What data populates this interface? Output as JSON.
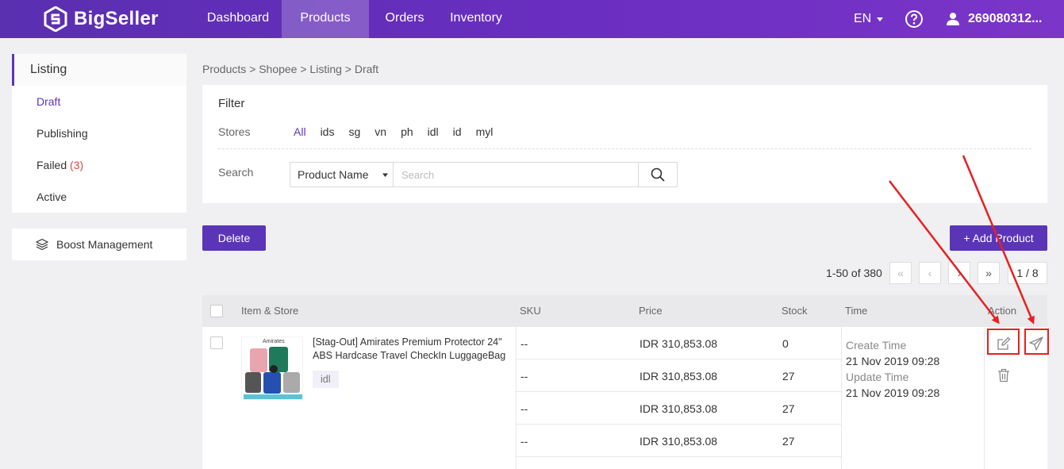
{
  "app": {
    "name": "BigSeller"
  },
  "nav": {
    "items": [
      {
        "label": "Dashboard"
      },
      {
        "label": "Products"
      },
      {
        "label": "Orders"
      },
      {
        "label": "Inventory"
      }
    ],
    "language": "EN",
    "user": "269080312..."
  },
  "sidebar": {
    "section": "Listing",
    "items": [
      {
        "label": "Draft"
      },
      {
        "label": "Publishing"
      },
      {
        "label": "Failed"
      },
      {
        "label": "Active"
      }
    ],
    "failed_count": "(3)",
    "boost": "Boost Management"
  },
  "breadcrumb": "Products > Shopee > Listing > Draft",
  "filter": {
    "title": "Filter",
    "stores_label": "Stores",
    "stores": [
      "All",
      "ids",
      "sg",
      "vn",
      "ph",
      "idl",
      "id",
      "myl"
    ],
    "search_label": "Search",
    "search_field": "Product Name",
    "search_placeholder": "Search"
  },
  "actions": {
    "delete": "Delete",
    "add_product": "+ Add Product"
  },
  "pagination": {
    "range": "1-50 of 380",
    "page": "1 / 8"
  },
  "table": {
    "headers": {
      "item": "Item & Store",
      "sku": "SKU",
      "price": "Price",
      "stock": "Stock",
      "time": "Time",
      "action": "Action"
    },
    "product": {
      "title": "[Stag-Out] Amirates Premium Protector 24\" ABS Hardcase Travel CheckIn LuggageBag",
      "store": "idl",
      "image_label": "Amirates"
    },
    "variants": [
      {
        "sku": "--",
        "price": "IDR 310,853.08",
        "stock": "0"
      },
      {
        "sku": "--",
        "price": "IDR 310,853.08",
        "stock": "27"
      },
      {
        "sku": "--",
        "price": "IDR 310,853.08",
        "stock": "27"
      },
      {
        "sku": "--",
        "price": "IDR 310,853.08",
        "stock": "27"
      }
    ],
    "time": {
      "create_label": "Create Time",
      "create_value": "21 Nov 2019 09:28",
      "update_label": "Update Time",
      "update_value": "21 Nov 2019 09:28"
    }
  },
  "colors": {
    "brand": "#5b35b8",
    "highlight": "#e82020"
  }
}
